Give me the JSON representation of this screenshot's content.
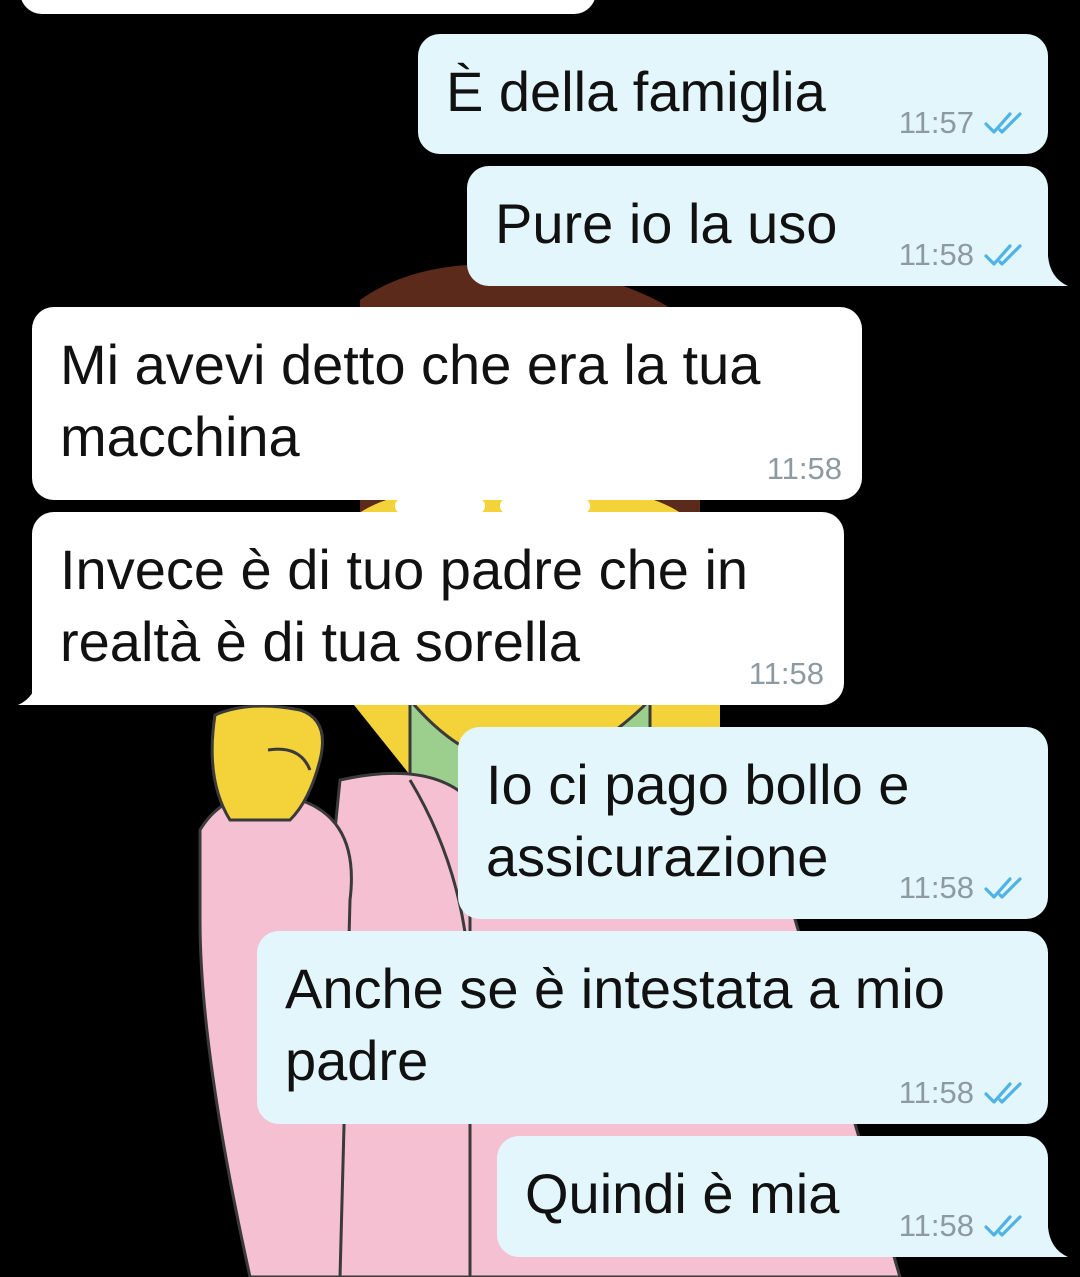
{
  "colors": {
    "background": "#000000",
    "outgoing_bubble": "#e3f6fb",
    "incoming_bubble": "#ffffff",
    "timestamp": "#8d9aa0",
    "read_ticks": "#4fb3e6"
  },
  "wallpaper": {
    "icon": "cartoon-figure-wallpaper"
  },
  "messages": [
    {
      "direction": "out",
      "text": "È della famiglia",
      "time": "11:57",
      "status_icon": "double-check-icon"
    },
    {
      "direction": "out",
      "text": "Pure io la uso",
      "time": "11:58",
      "status_icon": "double-check-icon"
    },
    {
      "direction": "in",
      "text": "Mi avevi detto che era la tua\nmacchina",
      "time": "11:58"
    },
    {
      "direction": "in",
      "text": "Invece è di tuo padre che in\nrealtà è di tua sorella",
      "time": "11:58"
    },
    {
      "direction": "out",
      "text": "Io ci pago bollo e\nassicurazione",
      "time": "11:58",
      "status_icon": "double-check-icon"
    },
    {
      "direction": "out",
      "text": "Anche se è intestata a mio\npadre",
      "time": "11:58",
      "status_icon": "double-check-icon"
    },
    {
      "direction": "out",
      "text": "Quindi è mia",
      "time": "11:58",
      "status_icon": "double-check-icon"
    }
  ]
}
